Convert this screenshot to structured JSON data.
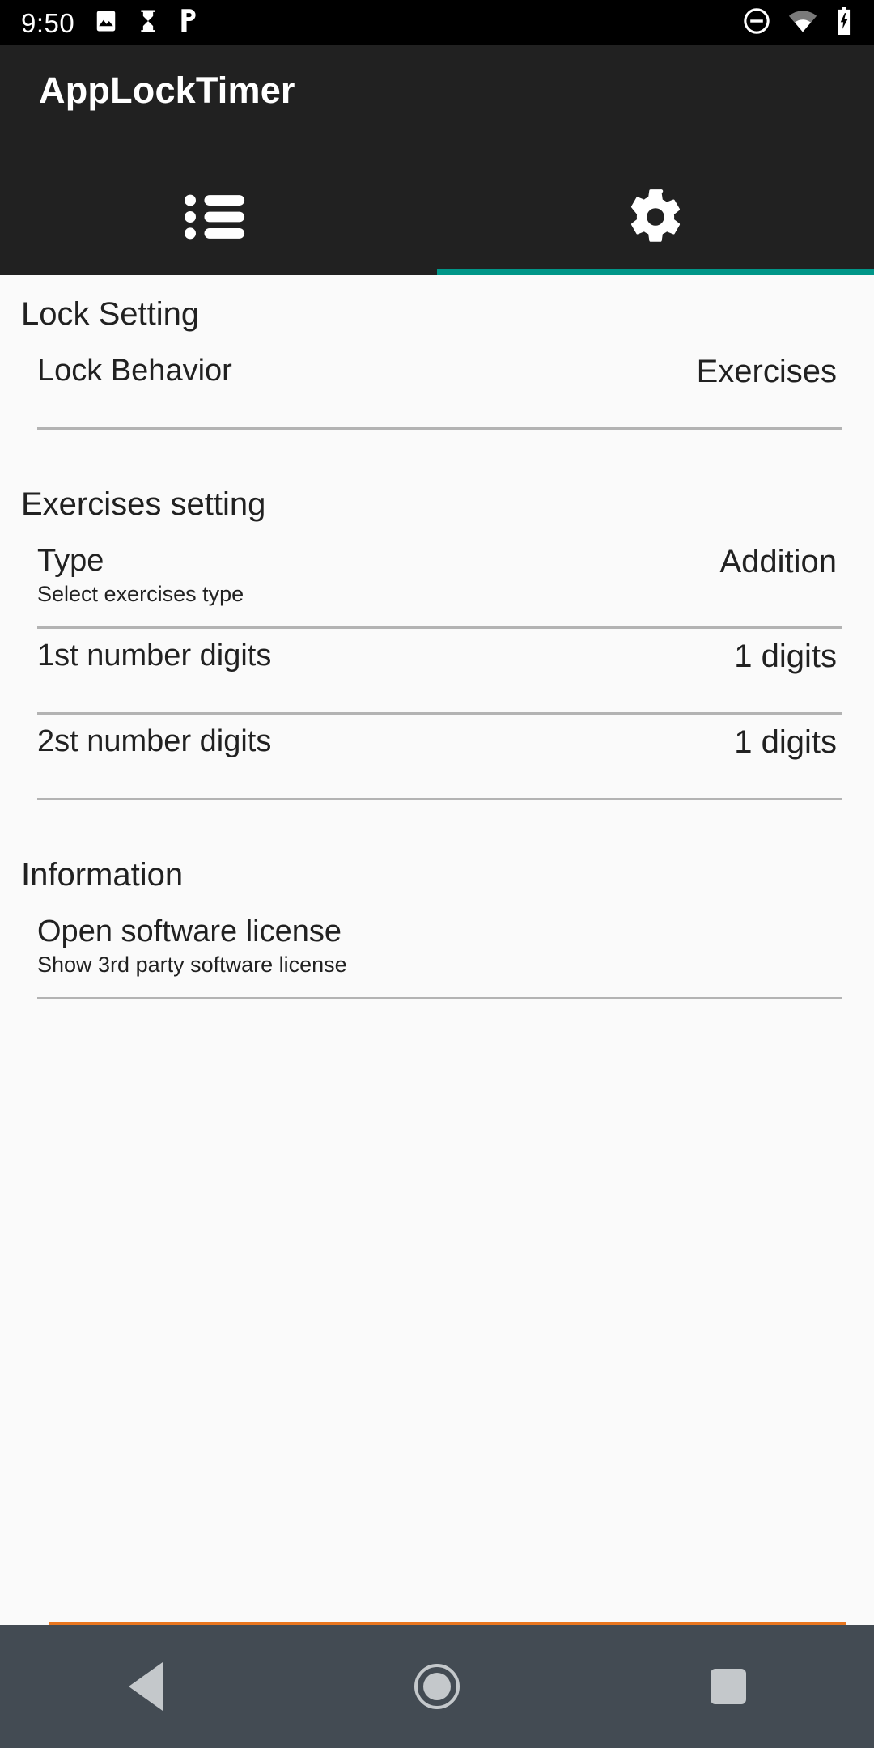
{
  "status_bar": {
    "time": "9:50",
    "left_icons": [
      "image-icon",
      "hourglass-icon",
      "pandora-icon"
    ],
    "right_icons": [
      "do-not-disturb-icon",
      "wifi-icon",
      "battery-charging-icon"
    ]
  },
  "app_bar": {
    "title": "AppLockTimer",
    "background_color": "#212121"
  },
  "tabs": {
    "indicator_color": "#009688",
    "items": [
      {
        "icon": "list-icon",
        "name": "tab-list",
        "active": false
      },
      {
        "icon": "gear-icon",
        "name": "tab-settings",
        "active": true
      }
    ]
  },
  "sections": [
    {
      "header": "Lock Setting",
      "rows": [
        {
          "title": "Lock Behavior",
          "summary": "",
          "value": "Exercises"
        }
      ]
    },
    {
      "header": "Exercises setting",
      "rows": [
        {
          "title": "Type",
          "summary": "Select exercises type",
          "value": "Addition"
        },
        {
          "title": "1st number digits",
          "summary": "",
          "value": "1 digits"
        },
        {
          "title": "2st number digits",
          "summary": "",
          "value": "1 digits"
        }
      ]
    },
    {
      "header": "Information",
      "rows": [
        {
          "title": "Open software license",
          "summary": "Show 3rd party software license",
          "value": ""
        }
      ]
    }
  ],
  "overscroll": {
    "color": "#e8761f"
  },
  "nav_bar": {
    "background_color": "#434b53",
    "buttons": [
      {
        "name": "nav-back-button",
        "icon": "back-triangle-icon"
      },
      {
        "name": "nav-home-button",
        "icon": "home-circle-icon"
      },
      {
        "name": "nav-recents-button",
        "icon": "recents-square-icon"
      }
    ]
  }
}
